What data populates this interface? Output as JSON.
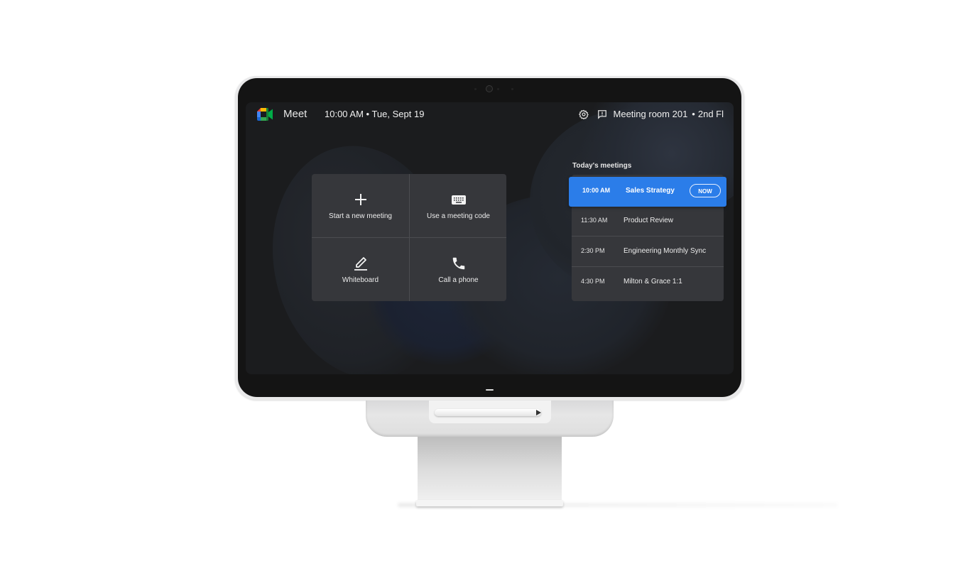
{
  "header": {
    "app_name": "Meet",
    "logo_icon": "google-meet-logo",
    "datetime": "10:00 AM • Tue, Sept 19",
    "settings_icon": "gear-icon",
    "feedback_icon": "feedback-icon",
    "room_name": "Meeting room 201",
    "room_separator": "•",
    "room_floor": "2nd Fl"
  },
  "actions": [
    {
      "label": "Start a new meeting",
      "icon": "plus-icon"
    },
    {
      "label": "Use a meeting code",
      "icon": "keyboard-icon"
    },
    {
      "label": "Whiteboard",
      "icon": "pen-icon"
    },
    {
      "label": "Call a phone",
      "icon": "phone-icon"
    }
  ],
  "meetings": {
    "title": "Today's meetings",
    "items": [
      {
        "time": "10:00 AM",
        "title": "Sales Strategy",
        "badge": "NOW",
        "active": true
      },
      {
        "time": "11:30 AM",
        "title": "Product Review"
      },
      {
        "time": "2:30 PM",
        "title": "Engineering Monthly Sync"
      },
      {
        "time": "4:30 PM",
        "title": "Milton & Grace 1:1"
      }
    ]
  },
  "colors": {
    "accent": "#2b7de9",
    "screen_bg": "#1b1c1e",
    "tile_bg": "#36373b"
  }
}
